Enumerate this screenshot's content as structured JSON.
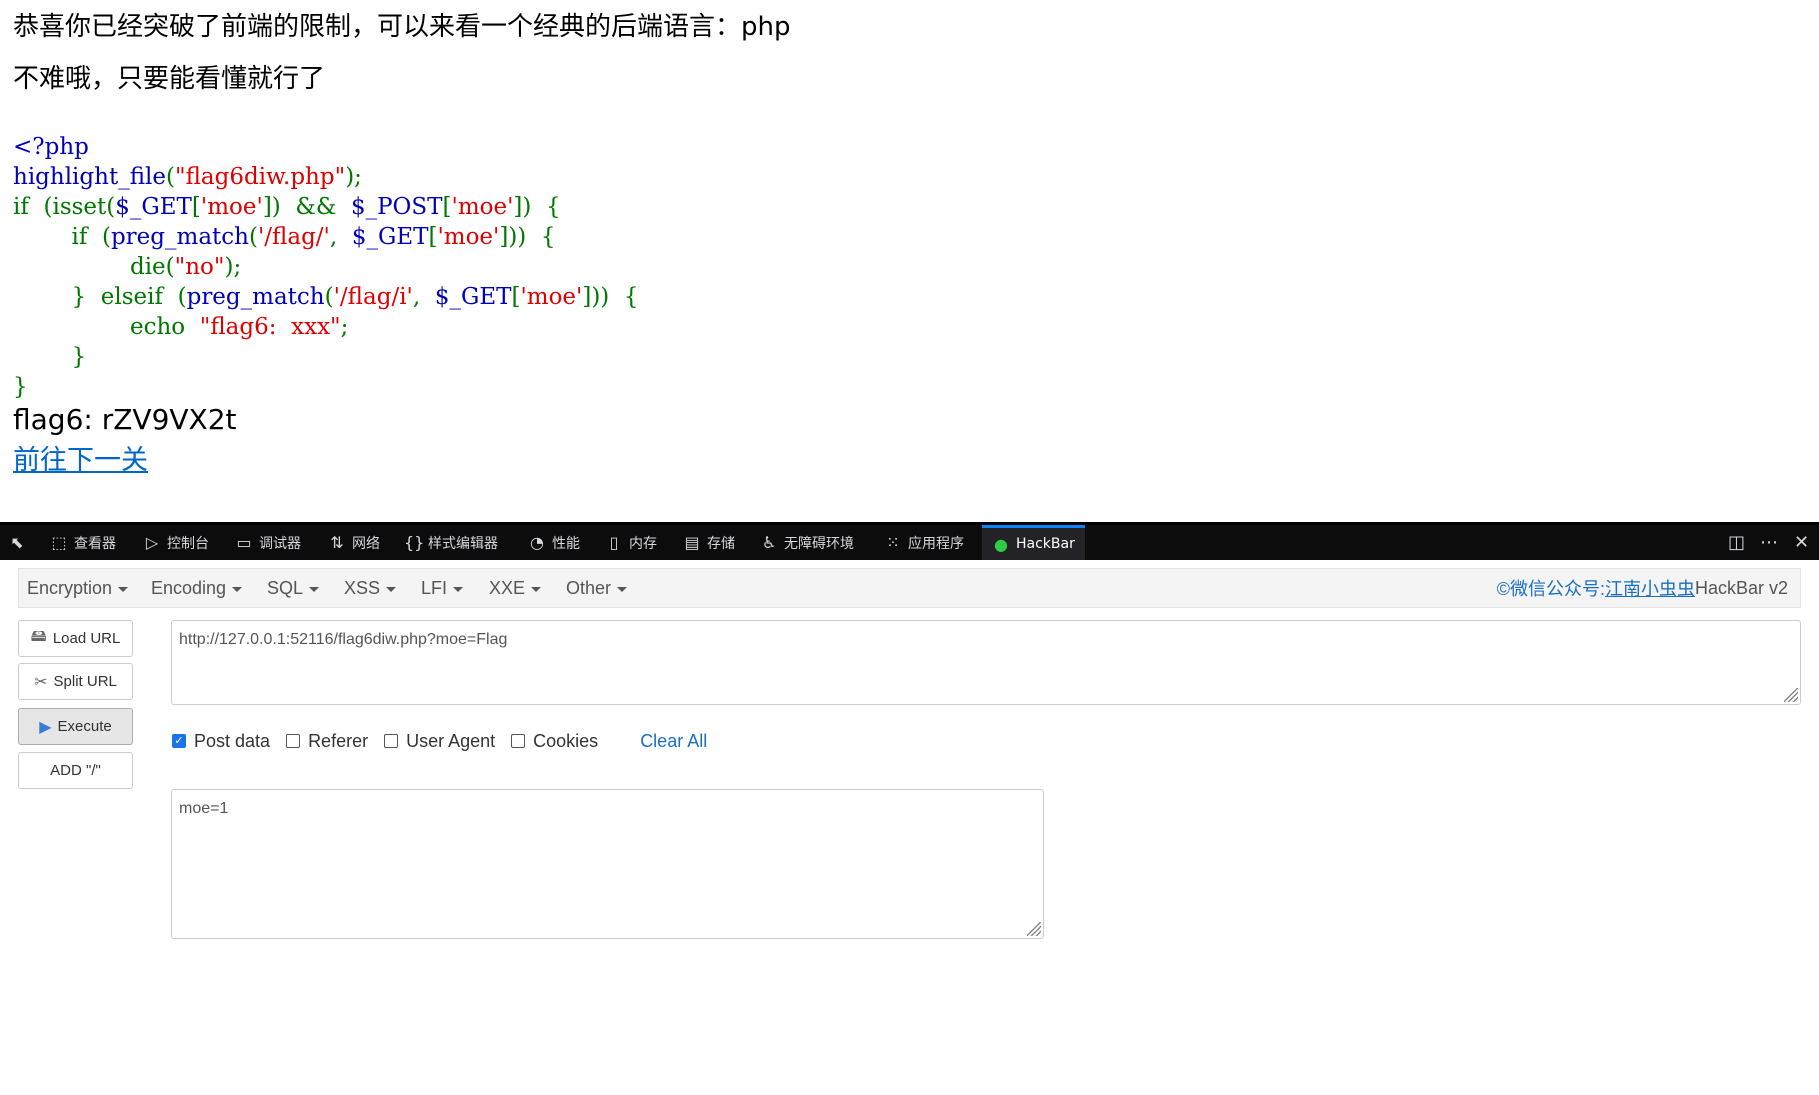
{
  "page": {
    "heading": "恭喜你已经突破了前端的限制，可以来看一个经典的后端语言：php",
    "subheading": "不难哦，只要能看懂就行了",
    "code_lines": [
      [
        {
          "t": "<?php",
          "c": "def"
        }
      ],
      [
        {
          "t": "highlight_file",
          "c": "def"
        },
        {
          "t": "(",
          "c": "kw"
        },
        {
          "t": "\"flag6diw.php\"",
          "c": "str"
        },
        {
          "t": ");",
          "c": "kw"
        }
      ],
      [
        {
          "t": "if  (isset(",
          "c": "kw"
        },
        {
          "t": "$_GET",
          "c": "def"
        },
        {
          "t": "[",
          "c": "kw"
        },
        {
          "t": "'moe'",
          "c": "str"
        },
        {
          "t": "])  &&  ",
          "c": "kw"
        },
        {
          "t": "$_POST",
          "c": "def"
        },
        {
          "t": "[",
          "c": "kw"
        },
        {
          "t": "'moe'",
          "c": "str"
        },
        {
          "t": "])  {",
          "c": "kw"
        }
      ],
      [
        {
          "t": "        if  (",
          "c": "kw"
        },
        {
          "t": "preg_match",
          "c": "def"
        },
        {
          "t": "(",
          "c": "kw"
        },
        {
          "t": "'/flag/'",
          "c": "str"
        },
        {
          "t": ",  ",
          "c": "kw"
        },
        {
          "t": "$_GET",
          "c": "def"
        },
        {
          "t": "[",
          "c": "kw"
        },
        {
          "t": "'moe'",
          "c": "str"
        },
        {
          "t": "]))  {",
          "c": "kw"
        }
      ],
      [
        {
          "t": "                die(",
          "c": "kw"
        },
        {
          "t": "\"no\"",
          "c": "str"
        },
        {
          "t": ");",
          "c": "kw"
        }
      ],
      [
        {
          "t": "        }  elseif  (",
          "c": "kw"
        },
        {
          "t": "preg_match",
          "c": "def"
        },
        {
          "t": "(",
          "c": "kw"
        },
        {
          "t": "'/flag/i'",
          "c": "str"
        },
        {
          "t": ",  ",
          "c": "kw"
        },
        {
          "t": "$_GET",
          "c": "def"
        },
        {
          "t": "[",
          "c": "kw"
        },
        {
          "t": "'moe'",
          "c": "str"
        },
        {
          "t": "]))  {",
          "c": "kw"
        }
      ],
      [
        {
          "t": "                echo  ",
          "c": "kw"
        },
        {
          "t": "\"flag6:  xxx\"",
          "c": "str"
        },
        {
          "t": ";",
          "c": "kw"
        }
      ],
      [
        {
          "t": "        }",
          "c": "kw"
        }
      ],
      [
        {
          "t": "}",
          "c": "kw"
        }
      ]
    ],
    "flag_output": "flag6: rZV9VX2t",
    "next_link": "前往下一关"
  },
  "devtools": {
    "tabs": [
      {
        "icon": "⬚",
        "label": "查看器",
        "name": "inspector"
      },
      {
        "icon": "▷",
        "label": "控制台",
        "name": "console"
      },
      {
        "icon": "▭",
        "label": "调试器",
        "name": "debugger"
      },
      {
        "icon": "⇅",
        "label": "网络",
        "name": "network"
      },
      {
        "icon": "{}",
        "label": "样式编辑器",
        "name": "style-editor"
      },
      {
        "icon": "◔",
        "label": "性能",
        "name": "performance"
      },
      {
        "icon": "▯",
        "label": "内存",
        "name": "memory"
      },
      {
        "icon": "▤",
        "label": "存储",
        "name": "storage"
      },
      {
        "icon": "♿",
        "label": "无障碍环境",
        "name": "accessibility"
      },
      {
        "icon": "⁙",
        "label": "应用程序",
        "name": "application"
      },
      {
        "icon": "●",
        "label": "HackBar",
        "name": "hackbar"
      }
    ],
    "active_tab": "HackBar"
  },
  "hackbar": {
    "menus": [
      "Encryption",
      "Encoding",
      "SQL",
      "XSS",
      "LFI",
      "XXE",
      "Other"
    ],
    "credit_prefix": "©微信公众号: ",
    "credit_link": "江南小虫虫",
    "credit_suffix": " HackBar v2",
    "buttons": {
      "load": "Load URL",
      "split": "Split URL",
      "execute": "Execute",
      "add": "ADD \"/\""
    },
    "url": "http://127.0.0.1:52116/flag6diw.php?moe=Flag",
    "options": {
      "post": "Post data",
      "referer": "Referer",
      "ua": "User Agent",
      "cookies": "Cookies",
      "clear": "Clear All"
    },
    "post_checked": true,
    "post_body": "moe=1"
  }
}
